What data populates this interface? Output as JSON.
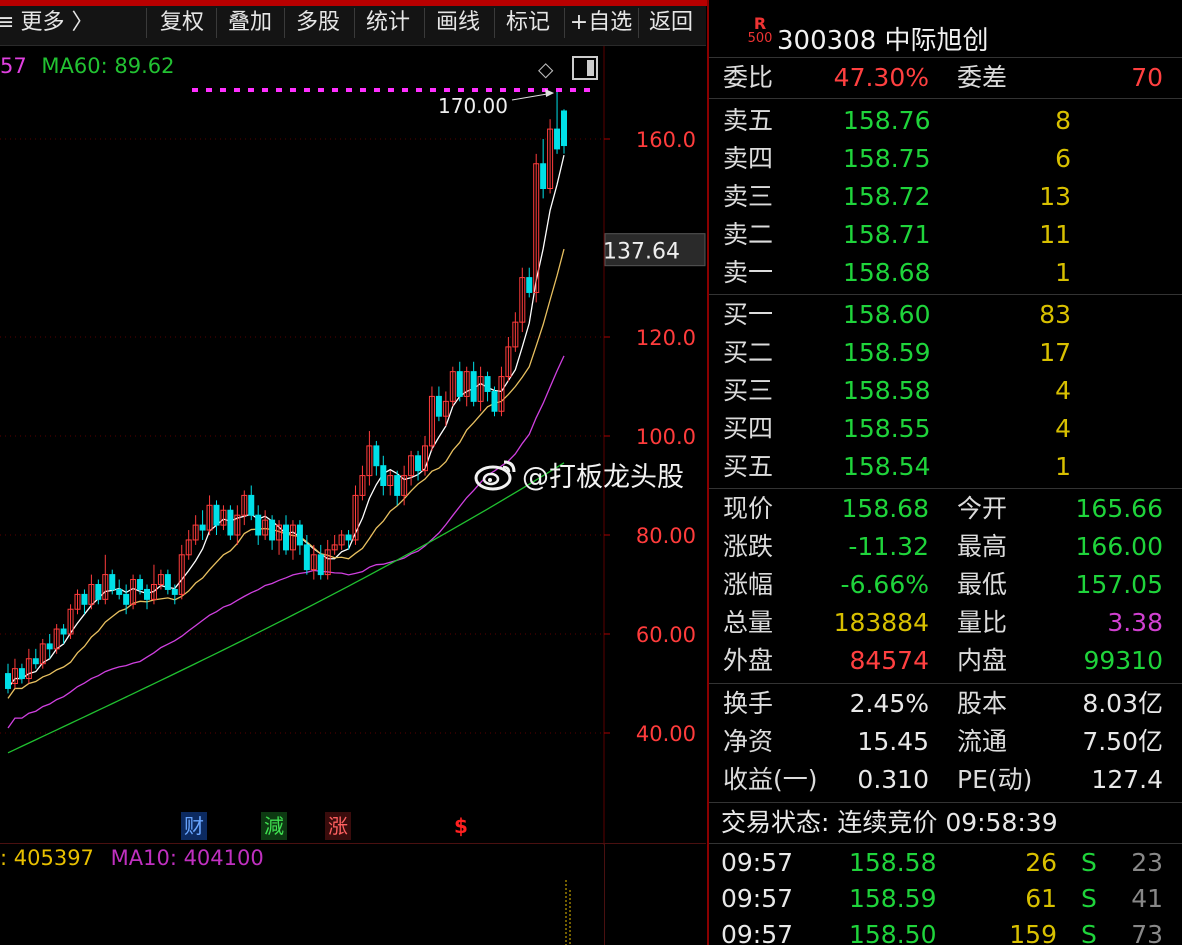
{
  "toolbar": {
    "cut_left": "≡",
    "more": "更多 〉",
    "buttons": [
      "复权",
      "叠加",
      "多股",
      "统计",
      "画线",
      "标记",
      "+自选",
      "返回"
    ]
  },
  "ma_legend": {
    "cut": "57",
    "ma60": "MA60: 89.62"
  },
  "price_axis": {
    "labels": [
      "160.0",
      "120.0",
      "100.0",
      "80.00",
      "60.00",
      "40.00"
    ],
    "current_tag": "137.64",
    "high_note": "170.00"
  },
  "events": [
    "财",
    "減",
    "涨",
    "$"
  ],
  "vol_legend": {
    "v1": ": 405397",
    "v2": "MA10: 404100"
  },
  "watermark": "@打板龙头股",
  "stock": {
    "badge_r": "R",
    "badge_n": "500",
    "title": "300308 中际旭创"
  },
  "weibi": {
    "label1": "委比",
    "value1": "47.30%",
    "label2": "委差",
    "value2": "70"
  },
  "asks": [
    {
      "label": "卖五",
      "price": "158.76",
      "vol": "8"
    },
    {
      "label": "卖四",
      "price": "158.75",
      "vol": "6"
    },
    {
      "label": "卖三",
      "price": "158.72",
      "vol": "13"
    },
    {
      "label": "卖二",
      "price": "158.71",
      "vol": "11"
    },
    {
      "label": "卖一",
      "price": "158.68",
      "vol": "1"
    }
  ],
  "bids": [
    {
      "label": "买一",
      "price": "158.60",
      "vol": "83"
    },
    {
      "label": "买二",
      "price": "158.59",
      "vol": "17"
    },
    {
      "label": "买三",
      "price": "158.58",
      "vol": "4"
    },
    {
      "label": "买四",
      "price": "158.55",
      "vol": "4"
    },
    {
      "label": "买五",
      "price": "158.54",
      "vol": "1"
    }
  ],
  "stats": [
    {
      "l1": "现价",
      "v1": "158.68",
      "c1": "green",
      "l2": "今开",
      "v2": "165.66",
      "c2": "green"
    },
    {
      "l1": "涨跌",
      "v1": "-11.32",
      "c1": "green",
      "l2": "最高",
      "v2": "166.00",
      "c2": "green"
    },
    {
      "l1": "涨幅",
      "v1": "-6.66%",
      "c1": "green",
      "l2": "最低",
      "v2": "157.05",
      "c2": "green"
    },
    {
      "l1": "总量",
      "v1": "183884",
      "c1": "yellow",
      "l2": "量比",
      "v2": "3.38",
      "c2": "purple"
    },
    {
      "l1": "外盘",
      "v1": "84574",
      "c1": "red",
      "l2": "内盘",
      "v2": "99310",
      "c2": "green"
    }
  ],
  "fundamentals": [
    {
      "l1": "换手",
      "v1": "2.45%",
      "l2": "股本",
      "v2": "8.03亿"
    },
    {
      "l1": "净资",
      "v1": "15.45",
      "l2": "流通",
      "v2": "7.50亿"
    },
    {
      "l1": "收益(一)",
      "v1": "0.310",
      "l2": "PE(动)",
      "v2": "127.4"
    }
  ],
  "trade_status": "交易状态: 连续竞价 09:58:39",
  "ticks": [
    {
      "time": "09:57",
      "price": "158.58",
      "vol": "26",
      "side": "S",
      "count": "23"
    },
    {
      "time": "09:57",
      "price": "158.59",
      "vol": "61",
      "side": "S",
      "count": "41"
    },
    {
      "time": "09:57",
      "price": "158.50",
      "vol": "159",
      "side": "S",
      "count": "73"
    }
  ],
  "colors": {
    "up": "#ff3c3c",
    "down": "#00e0e8",
    "ma5": "#ffffff",
    "ma10": "#e8c060",
    "ma20": "#d040e0",
    "ma60": "#20c030",
    "grid": "#5a0000"
  }
}
